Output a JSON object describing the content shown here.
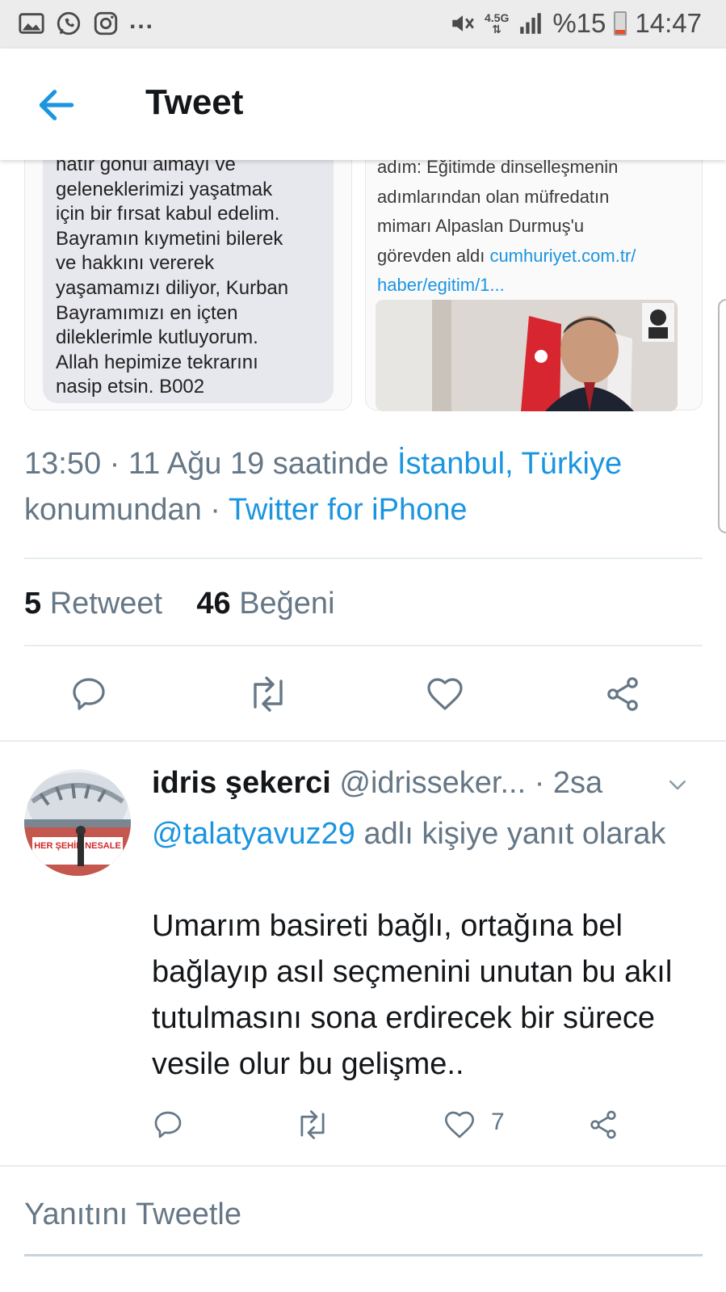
{
  "status_bar": {
    "dots": "...",
    "network": "4.5G",
    "battery": "%15",
    "time": "14:47"
  },
  "app_bar": {
    "title": "Tweet"
  },
  "media": {
    "sms_text": "hatır gönül almayı ve\ngeleneklerimizi yaşatmak\niçin bir fırsat kabul edelim.\nBayramın kıymetini bilerek\nve hakkını vererek\nyaşamamızı diliyor, Kurban\nBayramımızı en içten\ndileklerimle kutluyorum.\nAllah hepimize tekrarını\nnasip etsin. B002",
    "news_text": "adım: Eğitimde dinselleşmenin\nadımlarından olan müfredatın\nmimarı Alpaslan Durmuş'u\ngörevden aldı ",
    "news_link": "cumhuriyet.com.tr/\nhaber/egitim/1..."
  },
  "tweet_meta": {
    "time_date": "13:50 · 11 Ağu 19 saatinde ",
    "location": "İstanbul, Türkiye",
    "location_suffix": " konumundan · ",
    "source": "Twitter for iPhone"
  },
  "stats": {
    "retweet_count": "5",
    "retweet_label": "Retweet",
    "like_count": "46",
    "like_label": "Beğeni"
  },
  "reply": {
    "name": "idris şekerci",
    "handle": "@idrisseker...",
    "time": "· 2sa",
    "reply_to_handle": "@talatyavuz29",
    "reply_to_suffix": " adlı kişiye yanıt olarak",
    "text": "Umarım basireti bağlı, ortağına bel bağlayıp asıl seçmenini unutan bu akıl tutulmasını sona erdirecek bir sürece vesile olur bu gelişme..",
    "like_count": "7",
    "avatar_banner": "HER ŞEHİR NESALE"
  },
  "compose": {
    "placeholder": "Yanıtını Tweetle"
  },
  "colors": {
    "accent": "#1b95e0",
    "secondary_text": "#657786",
    "primary_text": "#14171a",
    "battery_low": "#e4502a"
  },
  "icons": [
    "gallery-icon",
    "whatsapp-icon",
    "instagram-icon",
    "mute-icon",
    "signal-icon",
    "battery-icon",
    "back-arrow-icon",
    "reply-icon",
    "retweet-icon",
    "like-icon",
    "share-icon",
    "chevron-down-icon"
  ]
}
